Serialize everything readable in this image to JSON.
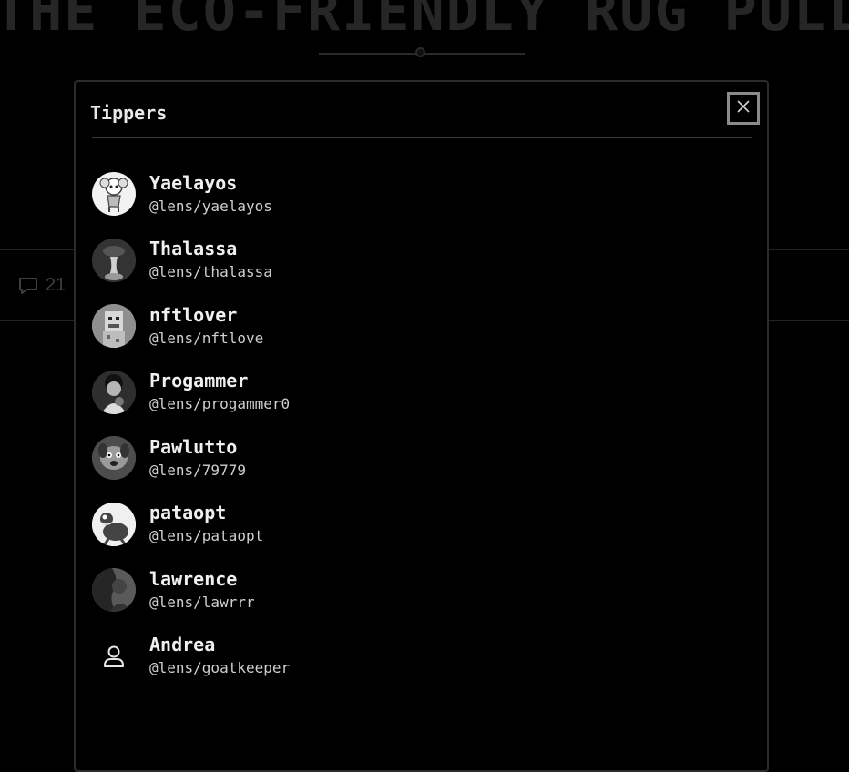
{
  "background": {
    "headline": "THE ECO-FRIENDLY RUG PULL",
    "comment_count": "21"
  },
  "modal": {
    "title": "Tippers",
    "close_icon": "close-icon",
    "tippers": [
      {
        "name": "Yaelayos",
        "handle": "@lens/yaelayos",
        "avatar": "cartoon-character-avatar"
      },
      {
        "name": "Thalassa",
        "handle": "@lens/thalassa",
        "avatar": "dark-figure-avatar"
      },
      {
        "name": "nftlover",
        "handle": "@lens/nftlove",
        "avatar": "pixel-ape-avatar"
      },
      {
        "name": "Progammer",
        "handle": "@lens/progammer0",
        "avatar": "portrait-avatar"
      },
      {
        "name": "Pawlutto",
        "handle": "@lens/79779",
        "avatar": "cartoon-dog-avatar"
      },
      {
        "name": "pataopt",
        "handle": "@lens/pataopt",
        "avatar": "frog-avatar"
      },
      {
        "name": "lawrence",
        "handle": "@lens/lawrrr",
        "avatar": "silhouette-avatar"
      },
      {
        "name": "Andrea",
        "handle": "@lens/goatkeeper",
        "avatar": "user-icon"
      }
    ]
  }
}
